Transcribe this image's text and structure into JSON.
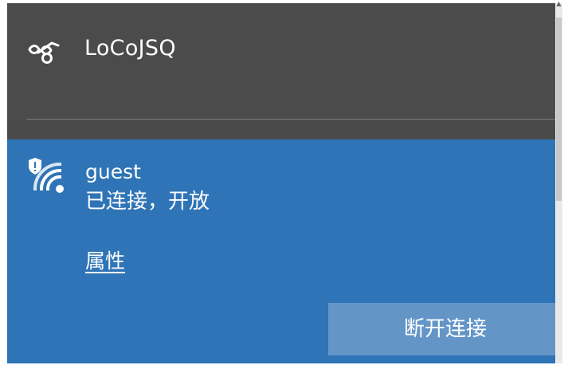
{
  "vpn": {
    "name": "LoCoJSQ",
    "icon": "vpn-link-icon"
  },
  "wifi": {
    "name": "guest",
    "status": "已连接，开放",
    "properties_link": "属性",
    "disconnect_label": "断开连接",
    "icon": "wifi-shield-icon"
  },
  "scrollbar": {
    "up_arrow": "▲"
  },
  "colors": {
    "panel_background": "#4a4a4a",
    "selected_background": "#2f74b6",
    "button_background": "#6395c7",
    "text": "#ffffff"
  }
}
